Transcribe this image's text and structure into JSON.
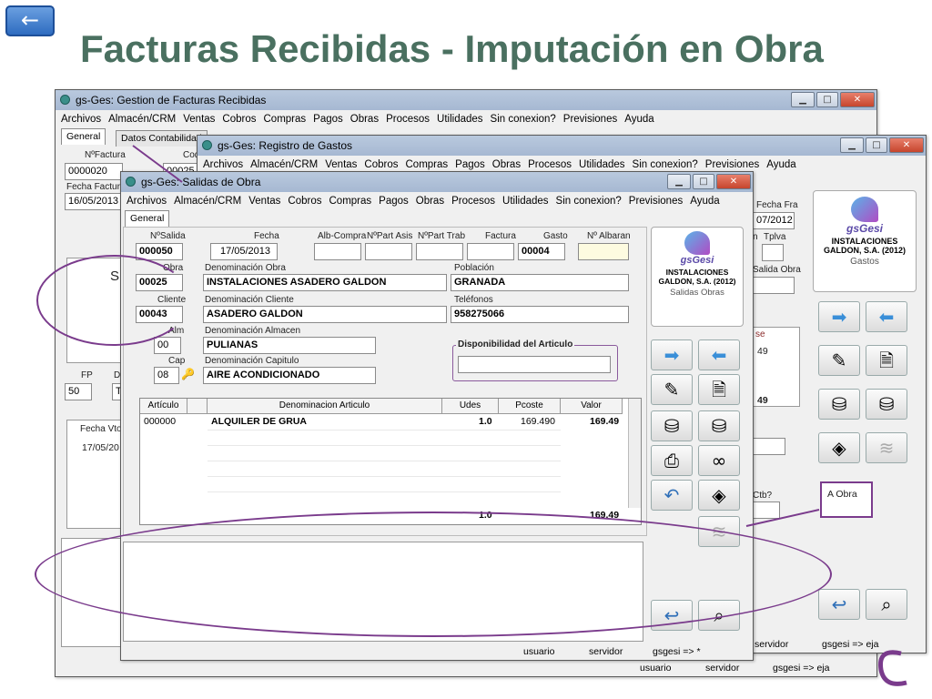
{
  "slide": {
    "back_icon": "←",
    "title": "Facturas Recibidas - Imputación en Obra"
  },
  "menu": [
    "Archivos",
    "Almacén/CRM",
    "Ventas",
    "Cobros",
    "Compras",
    "Pagos",
    "Obras",
    "Procesos",
    "Utilidades",
    "Sin conexion?",
    "Previsiones",
    "Ayuda"
  ],
  "win1": {
    "title": "gs-Ges: Gestion de Facturas Recibidas",
    "tabs": [
      "General",
      "Datos Contabilidad"
    ],
    "nfactura_label": "NºFactura",
    "nfactura": "0000020",
    "cod_label": "Cod",
    "cod": "00025",
    "fecha_factura_label": "Fecha Factur",
    "fecha_factura": "16/05/2013",
    "s_text": "S",
    "fp_label": "FP",
    "fp": "50",
    "d_label": "D",
    "t_text": "T",
    "fecha_vto_label": "Fecha Vto",
    "fecha_vto": "17/05/20",
    "status": {
      "user": "usuario",
      "server": "servidor",
      "gsgesi": "gsgesi => eja"
    }
  },
  "win2": {
    "title": "gs-Ges: Registro de Gastos",
    "fecha_fra_label": "Fecha Fra",
    "fecha_fra": "07/2012",
    "n_label": "n",
    "tplva_label": "Tplva",
    "salida_obra_label": "Salida Obra",
    "se_label": "se",
    "v1": "49",
    "v2": "49",
    "cto_label": "Ctb?",
    "a_obra": "A Obra",
    "logo": {
      "brand": "gsGesi",
      "company": "INSTALACIONES GALDON, S.A. (2012)",
      "module": "Gastos"
    },
    "status": {
      "server": "servidor",
      "gsgesi": "gsgesi => eja"
    }
  },
  "win3": {
    "title": "gs-Ges: Salidas de Obra",
    "tab": "General",
    "labels": {
      "nsalida": "NºSalida",
      "fecha": "Fecha",
      "albcompra": "Alb-Compra",
      "npartasis": "NºPart Asis",
      "nparttrab": "NºPart Trab",
      "factura": "Factura",
      "gasto": "Gasto",
      "nalbaran": "Nº Albaran",
      "obra": "Obra",
      "denobra": "Denominación Obra",
      "poblacion": "Población",
      "cliente": "Cliente",
      "dencliente": "Denominación Cliente",
      "telefonos": "Teléfonos",
      "alm": "Alm",
      "denalmacen": "Denominación Almacen",
      "cap": "Cap",
      "dencapitulo": "Denominación Capitulo",
      "disponibilidad": "Disponibilidad del Articulo"
    },
    "values": {
      "nsalida": "000050",
      "fecha": "17/05/2013",
      "gasto": "00004",
      "obra": "00025",
      "denobra": "INSTALACIONES ASADERO GALDON",
      "poblacion": "GRANADA",
      "cliente": "00043",
      "dencliente": "ASADERO GALDON",
      "telefonos": "958275066",
      "alm": "00",
      "denalmacen": "PULIANAS",
      "cap": "08",
      "dencapitulo": "AIRE ACONDICIONADO"
    },
    "grid": {
      "headers": [
        "Artículo",
        "",
        "Denominacion Articulo",
        "Udes",
        "Pcoste",
        "Valor"
      ],
      "row": {
        "articulo": "000000",
        "denominacion": "ALQUILER DE GRUA",
        "udes": "1.0",
        "pcoste": "169.490",
        "valor": "169.49"
      },
      "total_udes": "1.0",
      "total_valor": "169.49"
    },
    "logo": {
      "brand": "gsGesi",
      "company": "INSTALACIONES GALDON, S.A. (2012)",
      "module": "Salidas Obras"
    },
    "status": {
      "user": "usuario",
      "server": "servidor",
      "gsgesi": "gsgesi => *"
    }
  }
}
